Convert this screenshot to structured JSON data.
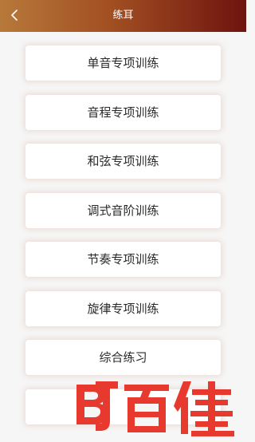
{
  "header": {
    "title": "练耳",
    "back_icon": "chevron-left-icon"
  },
  "menu": {
    "items": [
      {
        "label": "单音专项训练"
      },
      {
        "label": "音程专项训练"
      },
      {
        "label": "和弦专项训练"
      },
      {
        "label": "调式音阶训练"
      },
      {
        "label": "节奏专项训练"
      },
      {
        "label": "旋律专项训练"
      },
      {
        "label": "综合练习"
      },
      {
        "label": ""
      }
    ]
  },
  "watermark": {
    "text": "B百佳"
  },
  "colors": {
    "header_gradient": [
      "#b7793a",
      "#a24f22",
      "#6e140f"
    ],
    "background": "#f6f6f6",
    "card": "#ffffff",
    "watermark_red": "#e8392f"
  }
}
